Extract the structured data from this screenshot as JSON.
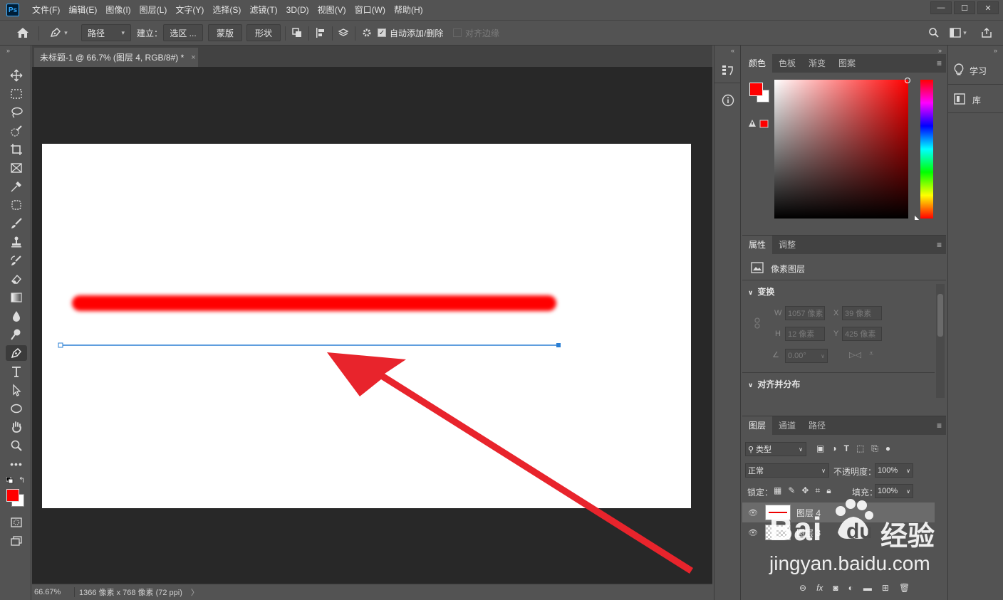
{
  "app": {
    "logo": "Ps"
  },
  "menu": [
    "文件(F)",
    "编辑(E)",
    "图像(I)",
    "图层(L)",
    "文字(Y)",
    "选择(S)",
    "滤镜(T)",
    "3D(D)",
    "视图(V)",
    "窗口(W)",
    "帮助(H)"
  ],
  "window_controls": [
    "—",
    "☐",
    "✕"
  ],
  "options": {
    "mode": "路径",
    "make_label": "建立：",
    "selection_btn": "选区 ...",
    "mask_btn": "蒙版",
    "shape_btn": "形状",
    "auto_add_delete": "自动添加/删除",
    "align_edges": "对齐边缘"
  },
  "document": {
    "tab_title": "未标题-1 @ 66.7% (图层 4, RGB/8#) *",
    "close": "×"
  },
  "status": {
    "zoom": "66.67%",
    "dimensions": "1366 像素 x 768 像素 (72 ppi)",
    "arrow": "〉"
  },
  "color_panel": {
    "tabs": [
      "颜色",
      "色板",
      "渐变",
      "图案"
    ],
    "foreground": "#ff0000",
    "background": "#ffffff"
  },
  "properties_panel": {
    "tabs": [
      "属性",
      "调整"
    ],
    "layer_type": "像素图层",
    "transform_header": "变换",
    "w_label": "W",
    "w_value": "1057 像素",
    "x_label": "X",
    "x_value": "39 像素",
    "h_label": "H",
    "h_value": "12 像素",
    "y_label": "Y",
    "y_value": "425 像素",
    "angle_value": "0.00°",
    "align_header": "对齐并分布"
  },
  "layers_panel": {
    "tabs": [
      "图层",
      "通道",
      "路径"
    ],
    "filter": "类型",
    "blend_mode": "正常",
    "opacity_label": "不透明度：",
    "opacity_value": "100%",
    "lock_label": "锁定：",
    "fill_label": "填充：",
    "fill_value": "100%",
    "layers": [
      {
        "name": "图层 4",
        "selected": true
      },
      {
        "name": "图层 3",
        "selected": false
      }
    ]
  },
  "far_right": {
    "learn": "学习",
    "library": "库"
  },
  "watermark": {
    "brand": "Bai",
    "brand2": "经验",
    "du": "du",
    "url": "jingyan.baidu.com"
  }
}
